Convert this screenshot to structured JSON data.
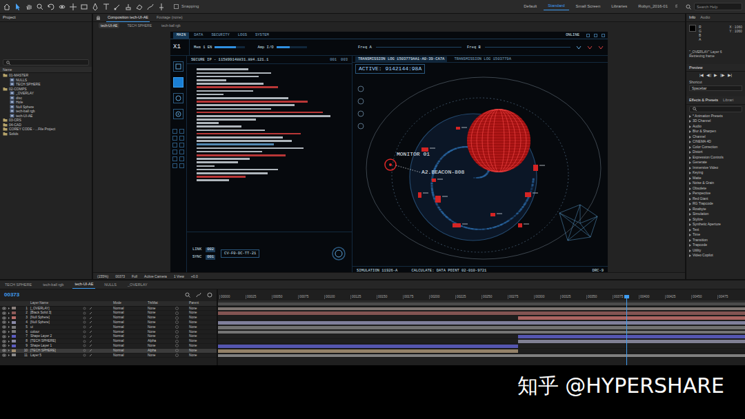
{
  "toolbar": {
    "snapping": {
      "label": "Snapping",
      "checked": false
    },
    "workspaces": [
      {
        "label": "Default",
        "selected": false
      },
      {
        "label": "Standard",
        "selected": true
      },
      {
        "label": "Small Screen",
        "selected": false
      },
      {
        "label": "Libraries",
        "selected": false
      },
      {
        "label": "Robyn_2016-01",
        "selected": false
      }
    ],
    "search": {
      "placeholder": "Search Help"
    }
  },
  "project": {
    "title": "Project",
    "column": "Name",
    "items": [
      {
        "label": "01-MASTER",
        "kind": "folder"
      },
      {
        "label": "NULLS",
        "kind": "comp"
      },
      {
        "label": "TECH SPHERE",
        "kind": "comp"
      },
      {
        "label": "02-COMPS",
        "kind": "folder"
      },
      {
        "label": "_OVERLAY",
        "kind": "comp"
      },
      {
        "label": "disc",
        "kind": "comp"
      },
      {
        "label": "Hole",
        "kind": "comp"
      },
      {
        "label": "Null Sphere",
        "kind": "comp"
      },
      {
        "label": "tech-ball rgb",
        "kind": "comp"
      },
      {
        "label": "tech-UI-AE",
        "kind": "comp"
      },
      {
        "label": "03-CRS",
        "kind": "folder"
      },
      {
        "label": "04-CAD",
        "kind": "folder"
      },
      {
        "label": "COREY CODE - ...File Project",
        "kind": "folder"
      },
      {
        "label": "Solids",
        "kind": "folder"
      }
    ]
  },
  "composition": {
    "panel_tabs": [
      {
        "label": "Composition tech-UI-AE",
        "selected": true
      },
      {
        "label": "Footage (none)",
        "selected": false
      }
    ],
    "comp_tabs": [
      {
        "label": "tech-UI-AE",
        "selected": true
      },
      {
        "label": "TECH SPHERE",
        "selected": false
      },
      {
        "label": "tech-ball rgb",
        "selected": false
      }
    ],
    "viewer_bar": [
      "(155%)",
      "00373",
      "Full",
      "Active Camera",
      "1 View",
      "+0.0"
    ]
  },
  "hud": {
    "nav": [
      {
        "label": "MAIN",
        "selected": true
      },
      {
        "label": "DATA",
        "selected": false
      },
      {
        "label": "SECURITY",
        "selected": false
      },
      {
        "label": "LOGS",
        "selected": false
      },
      {
        "label": "SYSTEM",
        "selected": false
      }
    ],
    "status": "ONLINE",
    "screen_id": "X1",
    "readouts": [
      {
        "label": "Mem 1 EN",
        "level": 0.7
      },
      {
        "label": "Amp I/O",
        "level": 0.45
      }
    ],
    "freq": [
      "Freq A",
      "Freq B"
    ],
    "tools": [
      {
        "selected": false
      },
      {
        "selected": true
      },
      {
        "selected": false
      },
      {
        "selected": false
      }
    ],
    "secure_ip": "SECURE IP - 115899148831.884.121.1",
    "code_tags": [
      "001",
      "003"
    ],
    "code_lines": [
      {
        "level": 0.35,
        "color": "#cfd6dd"
      },
      {
        "level": 0.5,
        "color": "#cfd6dd"
      },
      {
        "level": 0.42,
        "color": "#cfd6dd"
      },
      {
        "level": 0.2,
        "color": "#cfd6dd"
      },
      {
        "level": 0.45,
        "color": "#cfd6dd"
      },
      {
        "level": 0.55,
        "color": "#d94040"
      },
      {
        "level": 0.38,
        "color": "#cfd6dd"
      },
      {
        "level": 0.18,
        "color": "#cfd6dd"
      },
      {
        "level": 0.62,
        "color": "#cfd6dd"
      },
      {
        "level": 0.75,
        "color": "#d94040"
      },
      {
        "level": 0.66,
        "color": "#cfd6dd"
      },
      {
        "level": 0.5,
        "color": "#cfd6dd"
      },
      {
        "level": 0.85,
        "color": "#d94040"
      },
      {
        "level": 0.9,
        "color": "#cfd6dd"
      },
      {
        "level": 0.4,
        "color": "#cfd6dd"
      },
      {
        "level": 0.15,
        "color": "#cfd6dd"
      },
      {
        "level": 0.3,
        "color": "#cfd6dd"
      },
      {
        "level": 0.46,
        "color": "#cfd6dd"
      },
      {
        "level": 0.7,
        "color": "#d94040"
      },
      {
        "level": 0.58,
        "color": "#cfd6dd"
      },
      {
        "level": 0.64,
        "color": "#cfd6dd"
      },
      {
        "level": 0.52,
        "color": "#5f9fd0"
      },
      {
        "level": 0.72,
        "color": "#cfd6dd"
      },
      {
        "level": 0.44,
        "color": "#cfd6dd"
      },
      {
        "level": 0.6,
        "color": "#d94040"
      },
      {
        "level": 0.36,
        "color": "#cfd6dd"
      },
      {
        "level": 0.28,
        "color": "#cfd6dd"
      },
      {
        "level": 0.12,
        "color": "#cfd6dd"
      },
      {
        "level": 0.55,
        "color": "#cfd6dd"
      },
      {
        "level": 0.48,
        "color": "#cfd6dd"
      },
      {
        "level": 0.33,
        "color": "#d94040"
      },
      {
        "level": 0.22,
        "color": "#cfd6dd"
      }
    ],
    "links": [
      {
        "label": "LINK",
        "value": "002"
      },
      {
        "label": "SYNC",
        "value": "001"
      }
    ],
    "ref": "CV-F0-DC-TT-21",
    "transmission_tabs": [
      {
        "label": "TRANSMISSION LOG 1503779AA1-A0-39-CA7A",
        "selected": true
      },
      {
        "label": "TRANSMISSION LOG 1503779A",
        "selected": false
      }
    ],
    "active": "ACTIVE: 9142144:98A",
    "monitor": "MONITOR 01",
    "beacon": "A2.BEACON-808",
    "simulation": "SIMULATION 11926-A",
    "calculate": "CALCULATE: DATA POINT 02-010-9721",
    "drc": "DRC-9"
  },
  "info": {
    "tabs": [
      {
        "label": "Info",
        "selected": true
      },
      {
        "label": "Audio",
        "selected": false
      }
    ],
    "channels": [
      "R",
      "G",
      "B",
      "A"
    ],
    "x": "X : 1060",
    "y": "Y : 1060",
    "layer": "\"_OVERLAY\" Layer 6",
    "status": "Retrieving frame"
  },
  "preview": {
    "title": "Preview",
    "controls": [
      "|◀",
      "◀|",
      "▶",
      "|▶",
      "▶|"
    ],
    "shortcut_label": "Shortcut",
    "shortcut": "Spacebar"
  },
  "effects": {
    "tabs": [
      {
        "label": "Effects & Presets",
        "selected": true
      },
      {
        "label": "Librari",
        "selected": false
      }
    ],
    "items": [
      "* Animation Presets",
      "3D Channel",
      "Audio",
      "Blur & Sharpen",
      "Channel",
      "CINEMA 4D",
      "Color Correction",
      "Distort",
      "Expression Controls",
      "Generate",
      "Immersive Video",
      "Keying",
      "Matte",
      "Noise & Grain",
      "Obsolete",
      "Perspective",
      "Red Giant",
      "RG Trapcode",
      "Rowbyte",
      "Simulation",
      "Stylize",
      "Synthetic Aperture",
      "Text",
      "Time",
      "Transition",
      "Trapcode",
      "Utility",
      "Video Copilot"
    ]
  },
  "timeline": {
    "tabs": [
      {
        "label": "TECH SPHERE",
        "selected": false
      },
      {
        "label": "tech-ball rgb",
        "selected": false
      },
      {
        "label": "tech-UI-AE",
        "selected": true
      },
      {
        "label": "NULLS",
        "selected": false
      },
      {
        "label": "_OVERLAY",
        "selected": false
      }
    ],
    "time": "00373",
    "columns": [
      "Layer Name",
      "Mode",
      "TrkMat",
      "Parent"
    ],
    "layers": [
      {
        "num": "1",
        "name": "[_OVERLAY]",
        "mode": "Normal",
        "trkmat": "None",
        "parent": "None",
        "start": 0,
        "end": 1,
        "color": "#8a7f7b",
        "selected": false
      },
      {
        "num": "2",
        "name": "[Black Solid 3]",
        "mode": "Normal",
        "trkmat": "None",
        "parent": "None",
        "start": 0,
        "end": 1,
        "color": "#8e5a58",
        "selected": false
      },
      {
        "num": "3",
        "name": "[Null Sphere]",
        "mode": "Normal",
        "trkmat": "None",
        "parent": "None",
        "start": 0.57,
        "end": 1,
        "color": "#b86c68",
        "selected": false
      },
      {
        "num": "4",
        "name": "[Null Sphere]",
        "mode": "Normal",
        "trkmat": "None",
        "parent": "None",
        "start": 0,
        "end": 1,
        "color": "#8a8aa8",
        "selected": false
      },
      {
        "num": "5",
        "name": "ui",
        "mode": "Normal",
        "trkmat": "None",
        "parent": "None",
        "start": 0,
        "end": 1,
        "color": "#7a7a7a",
        "selected": false
      },
      {
        "num": "6",
        "name": "colour",
        "mode": "Normal",
        "trkmat": "None",
        "parent": "None",
        "start": 0,
        "end": 1,
        "color": "#7d7d7d",
        "selected": false
      },
      {
        "num": "7",
        "name": "Shape Layer 2",
        "mode": "Normal",
        "trkmat": "None",
        "parent": "None",
        "start": 0.57,
        "end": 1,
        "color": "#5b5cc0",
        "selected": false
      },
      {
        "num": "8",
        "name": "[TECH SPHERE]",
        "mode": "Normal",
        "trkmat": "Alpha",
        "parent": "None",
        "start": 0.57,
        "end": 1,
        "color": "#8a8aa0",
        "selected": false
      },
      {
        "num": "9",
        "name": "Shape Layer 1",
        "mode": "Normal",
        "trkmat": "None",
        "parent": "None",
        "start": 0,
        "end": 0.57,
        "color": "#5b5cc0",
        "selected": false
      },
      {
        "num": "10",
        "name": "[TECH SPHERE]",
        "mode": "Normal",
        "trkmat": "Alpha",
        "parent": "None",
        "start": 0,
        "end": 0.57,
        "color": "#a08c70",
        "selected": true
      },
      {
        "num": "11",
        "name": "Layer 5",
        "mode": "Normal",
        "trkmat": "None",
        "parent": "None",
        "start": 0,
        "end": 1,
        "color": "#8a8a8a",
        "selected": false
      }
    ],
    "ruler": [
      "00000",
      "00025",
      "00050",
      "00075",
      "00100",
      "00125",
      "00150",
      "00175",
      "00200",
      "00225",
      "00250",
      "00275",
      "00300",
      "00325",
      "00350",
      "00375",
      "00400",
      "00425",
      "00450",
      "00475"
    ],
    "playhead": 0.775
  },
  "watermark": "知乎 @HYPERSHARE"
}
